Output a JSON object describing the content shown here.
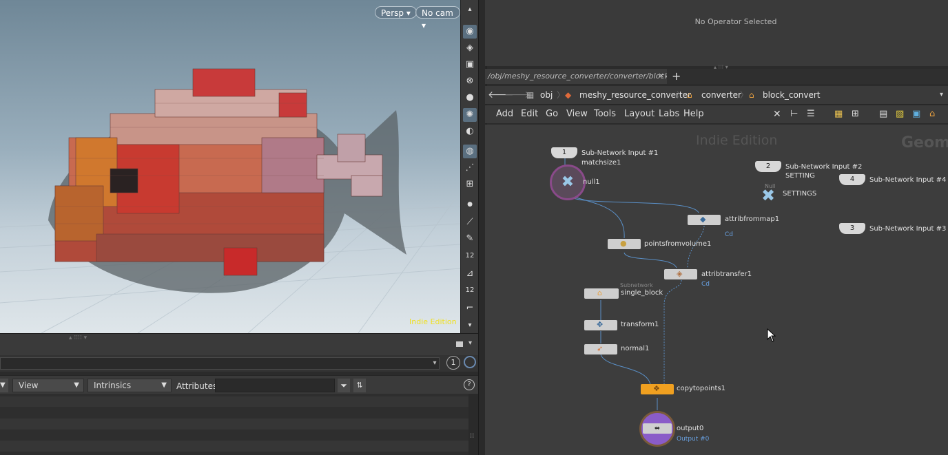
{
  "viewport": {
    "persp_label": "Persp",
    "cam_label": "No cam",
    "edition_label": "Indie Edition"
  },
  "viewport_toolbar": {
    "icons": [
      "eye-icon",
      "display-options-icon",
      "lock-icon",
      "ghost-icon",
      "shading-icon",
      "light-icon",
      "camera-icon",
      "render-icon",
      "particle-icon",
      "snapshot-icon",
      "point-icon",
      "edge-icon",
      "brush-icon",
      "num-12-icon",
      "snap-icon",
      "num-12b-icon",
      "measure-icon",
      "more-icon"
    ]
  },
  "spreadsheet": {
    "node_count": "1",
    "view_label": "View",
    "intrinsics_label": "Intrinsics",
    "attributes_label": "Attributes:",
    "attributes_value": ""
  },
  "param_pane": {
    "no_operator": "No Operator Selected"
  },
  "network_tab": {
    "path": "/obj/meshy_resource_converter/converter/block_con...",
    "close": "×",
    "add": "+"
  },
  "breadcrumbs": [
    "obj",
    "meshy_resource_converter",
    "converter",
    "block_convert"
  ],
  "menus": [
    "Add",
    "Edit",
    "Go",
    "View",
    "Tools",
    "Layout",
    "Labs",
    "Help"
  ],
  "network": {
    "watermark": "Indie Edition",
    "context_watermark": "Geom",
    "nodes": {
      "subnet_input_1": {
        "number": "1",
        "label": "Sub-Network Input #1",
        "sub": "matchsize1"
      },
      "null1": {
        "label": "null1"
      },
      "subnet_input_2": {
        "number": "2",
        "label": "Sub-Network Input #2",
        "sub": "SETTING"
      },
      "settings": {
        "type": "Null",
        "label": "SETTINGS"
      },
      "subnet_input_4": {
        "number": "4",
        "label": "Sub-Network Input #4"
      },
      "subnet_input_3": {
        "number": "3",
        "label": "Sub-Network Input #3"
      },
      "attribfrommap1": {
        "label": "attribfrommap1",
        "sub": "Cd"
      },
      "pointsfromvolume1": {
        "label": "pointsfromvolume1"
      },
      "attribtransfer1": {
        "label": "attribtransfer1",
        "sub": "Cd"
      },
      "single_block": {
        "type": "Subnetwork",
        "label": "single_block"
      },
      "transform1": {
        "label": "transform1"
      },
      "normal1": {
        "label": "normal1"
      },
      "copytopoints1": {
        "label": "copytopoints1"
      },
      "output0": {
        "label": "output0",
        "sub": "Output #0"
      }
    }
  },
  "colors": {
    "accent_orange": "#f0a020",
    "wire": "#5a90c8",
    "edition_yellow": "#f0e020",
    "output_purple": "#8a5cc8"
  }
}
